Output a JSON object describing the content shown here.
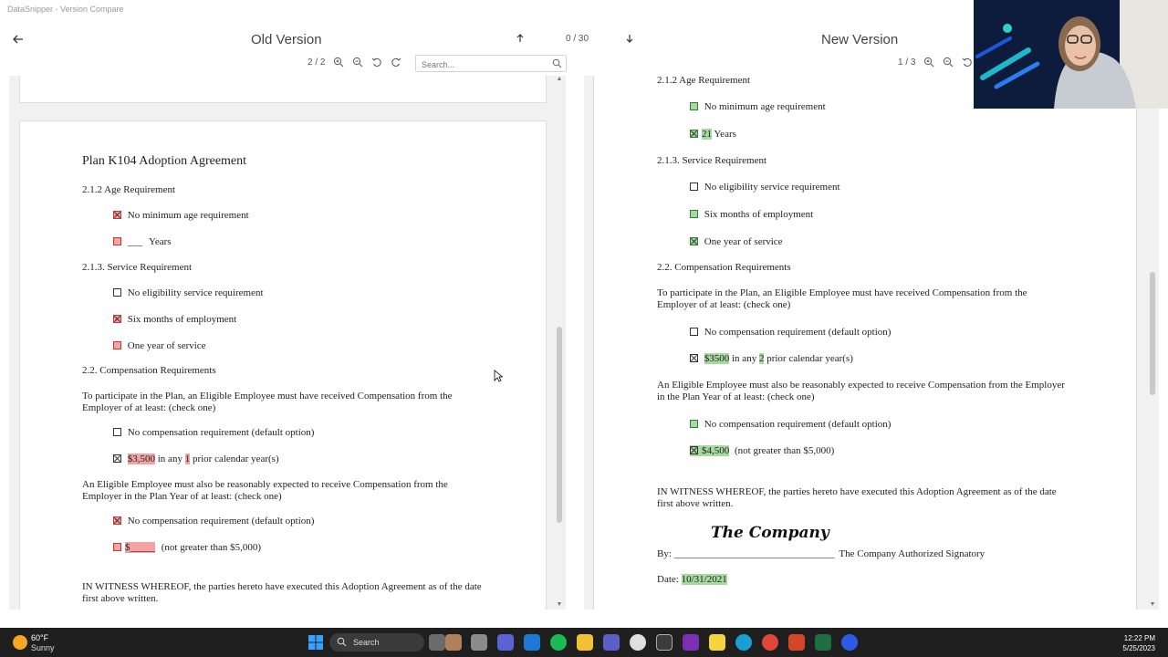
{
  "app": {
    "title": "DataSnipper - Version Compare"
  },
  "header": {
    "old_title": "Old Version",
    "new_title": "New Version",
    "diff_counter": "0 / 30"
  },
  "toolbar": {
    "old_page": "2 / 2",
    "new_page": "1 / 3",
    "search_placeholder": "Search..."
  },
  "old_doc": {
    "title": "Plan K104 Adoption Agreement",
    "age_req": "2.1.2 Age Requirement",
    "no_min_age": "No minimum age requirement",
    "years_blank": "___",
    "years_label": "Years",
    "service_req": "2.1.3. Service Requirement",
    "no_service": "No eligibility service requirement",
    "six_months": "Six months of employment",
    "one_year": "One year of service",
    "comp_req": "2.2. Compensation Requirements",
    "comp_para": "To participate in the Plan, an Eligible Employee must have received Compensation from the Employer of at least: (check one)",
    "no_comp": "No compensation requirement (default option)",
    "amount": "$3,500",
    "in_any": "in any",
    "years_count": "1",
    "prior": "prior calendar year(s)",
    "expect_para": "An Eligible Employee must also be reasonably expected to receive Compensation from the Employer in the Plan Year of at least: (check one)",
    "no_comp2": "No compensation requirement (default option)",
    "dollar_blank": "$_____",
    "not_greater": "(not greater than $5,000)",
    "witness": "IN WITNESS WHEREOF, the parties hereto have executed this Adoption Agreement as of the date first above written."
  },
  "new_doc": {
    "age_req": "2.1.2 Age Requirement",
    "no_min_age": "No minimum age requirement",
    "years_num": "21",
    "years_label": "Years",
    "service_req": "2.1.3. Service Requirement",
    "no_service": "No eligibility service requirement",
    "six_months": "Six months of employment",
    "one_year": "One year of service",
    "comp_req": "2.2. Compensation Requirements",
    "comp_para": "To participate in the Plan, an Eligible Employee must have received Compensation from the Employer of at least: (check one)",
    "no_comp": "No compensation requirement (default option)",
    "amount": "$3500",
    "in_any": "in any",
    "years_count": "2",
    "prior": "prior calendar year(s)",
    "expect_para": "An Eligible Employee must also be reasonably expected to receive Compensation from the Employer in the Plan Year of at least: (check one)",
    "no_comp2": "No compensation requirement (default option)",
    "amount2": "$4,500",
    "not_greater": "(not greater than $5,000)",
    "witness": "IN WITNESS WHEREOF, the parties hereto have executed this Adoption Agreement as of the date first above written.",
    "signature": "The Company",
    "by_label": "By:",
    "by_line": "________________________________",
    "signatory": "The Company Authorized Signatory",
    "date_label": "Date:",
    "date_value": "10/31/2021"
  },
  "taskbar": {
    "temp": "60°F",
    "condition": "Sunny",
    "search_label": "Search",
    "time": "12:22 PM",
    "date": "5/25/2023"
  },
  "icons": {
    "back": "arrow-left-icon",
    "up": "arrow-up-icon",
    "down": "arrow-down-icon",
    "zoom_in": "zoom-in-icon",
    "zoom_out": "zoom-out-icon",
    "rotate_left": "rotate-left-icon",
    "rotate_right": "rotate-right-icon",
    "search": "search-icon"
  },
  "colors": {
    "removed": "#f4a3a3",
    "added": "#a6d9a0"
  }
}
